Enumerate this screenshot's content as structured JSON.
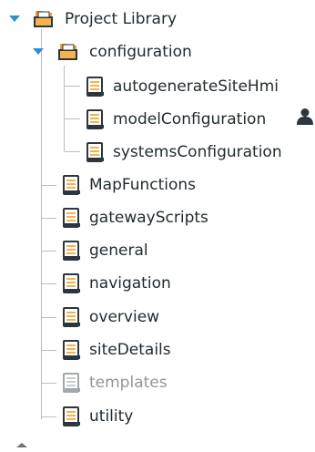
{
  "tree": {
    "root": {
      "label": "Project Library",
      "expanded": true,
      "icon": "folder-open-icon"
    },
    "folder": {
      "label": "configuration",
      "expanded": true,
      "icon": "folder-open-icon"
    },
    "children": [
      {
        "label": "autogenerateSiteHmi",
        "icon": "script-icon"
      },
      {
        "label": "modelConfiguration",
        "icon": "script-icon",
        "badge": "user-icon"
      },
      {
        "label": "systemsConfiguration",
        "icon": "script-icon"
      }
    ],
    "items": [
      {
        "label": "MapFunctions",
        "icon": "script-icon",
        "muted": false
      },
      {
        "label": "gatewayScripts",
        "icon": "script-icon",
        "muted": false
      },
      {
        "label": "general",
        "icon": "script-icon",
        "muted": false
      },
      {
        "label": "navigation",
        "icon": "script-icon",
        "muted": false
      },
      {
        "label": "overview",
        "icon": "script-icon",
        "muted": false
      },
      {
        "label": "siteDetails",
        "icon": "script-icon",
        "muted": false
      },
      {
        "label": "templates",
        "icon": "script-icon",
        "muted": true
      },
      {
        "label": "utility",
        "icon": "script-icon",
        "muted": false
      }
    ]
  },
  "colors": {
    "accent": "#2b8fd6",
    "script_border": "#2b3640",
    "script_fill": "#f6b24d",
    "folder": "#e8a23a",
    "muted": "#a2a8ac",
    "guide": "#b9bec2"
  }
}
